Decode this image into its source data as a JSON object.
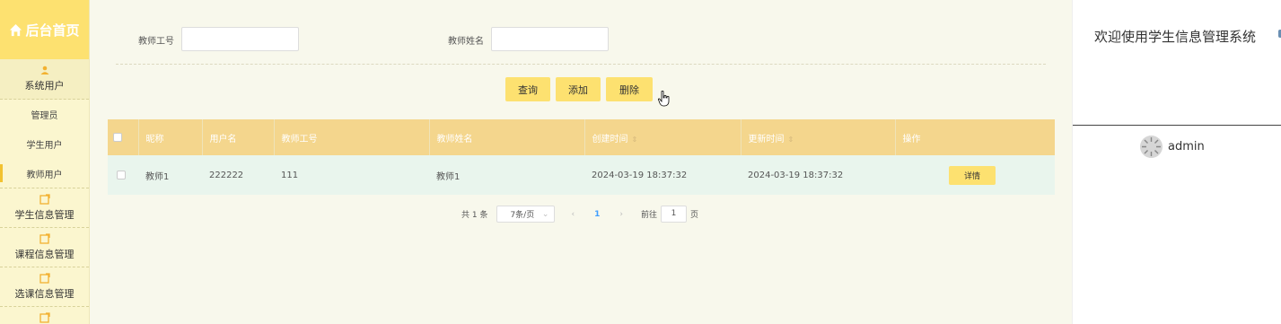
{
  "sidebar": {
    "brand": "后台首页",
    "groups": [
      {
        "label": "系统用户",
        "items": [
          "管理员",
          "学生用户",
          "教师用户"
        ]
      },
      {
        "label": "学生信息管理"
      },
      {
        "label": "课程信息管理"
      },
      {
        "label": "选课信息管理"
      }
    ],
    "active_item": "教师用户"
  },
  "search": {
    "teacher_no_label": "教师工号",
    "teacher_no_value": "",
    "teacher_name_label": "教师姓名",
    "teacher_name_value": ""
  },
  "actions": {
    "query": "查询",
    "add": "添加",
    "delete": "删除"
  },
  "table": {
    "columns": [
      "昵称",
      "用户名",
      "教师工号",
      "教师姓名",
      "创建时间",
      "更新时间",
      "操作"
    ],
    "rows": [
      {
        "nickname": "教师1",
        "username": "222222",
        "teacher_no": "111",
        "teacher_name": "教师1",
        "created": "2024-03-19 18:37:32",
        "updated": "2024-03-19 18:37:32",
        "action": "详情"
      }
    ]
  },
  "pagination": {
    "total_text": "共 1 条",
    "page_size": "7条/页",
    "current_page": "1",
    "goto_label": "前往",
    "goto_value": "1",
    "page_suffix": "页"
  },
  "right_panel": {
    "welcome": "欢迎使用学生信息管理系统",
    "username": "admin"
  },
  "colors": {
    "accent": "#fde170",
    "sidebar_bg": "#fbf6cf",
    "table_header": "#f4d68d",
    "row_bg": "#e9f5ed",
    "active_page": "#409eff"
  }
}
